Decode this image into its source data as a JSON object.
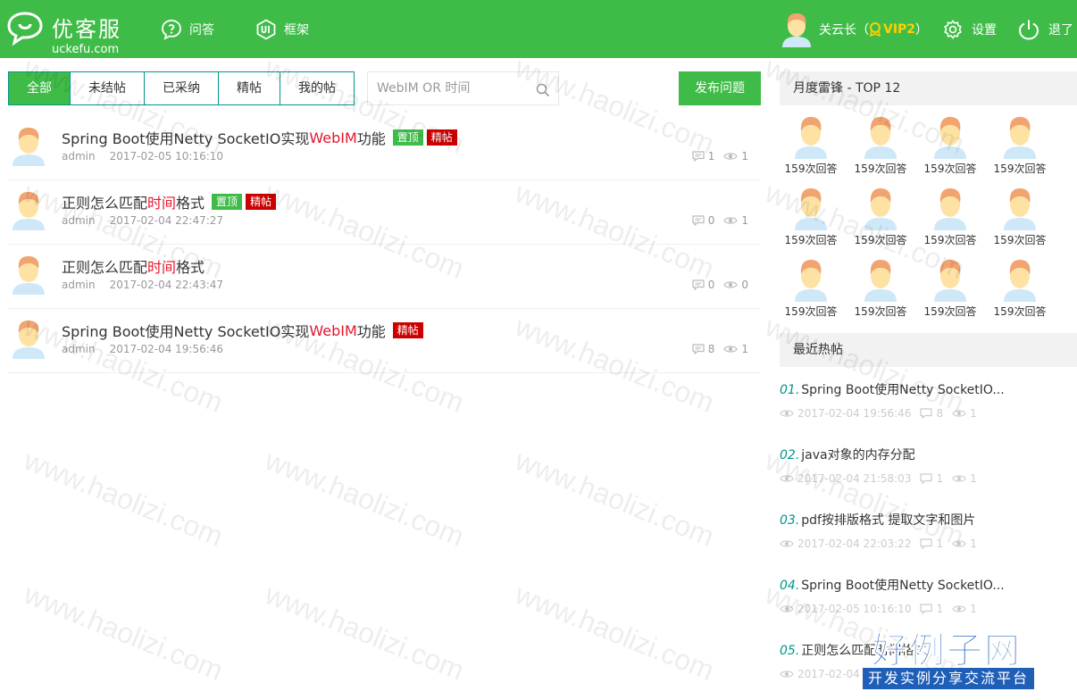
{
  "header": {
    "logo_name": "优客服",
    "logo_domain": "uckefu.com",
    "nav": [
      {
        "label": "问答",
        "icon": "question-bubble-icon"
      },
      {
        "label": "框架",
        "icon": "ui-framework-icon"
      }
    ],
    "user": {
      "name": "关云长（",
      "vip": "VIP2",
      "close": "）"
    },
    "settings_label": "设置",
    "logout_label": "退了"
  },
  "tabs": [
    "全部",
    "未结帖",
    "已采纳",
    "精帖",
    "我的帖"
  ],
  "search": {
    "placeholder": "WebIM OR 时间"
  },
  "publish_label": "发布问题",
  "posts": [
    {
      "pre": "Spring Boot使用Netty SocketIO实现",
      "hl": "WebIM",
      "post": "功能",
      "badges": [
        "置顶",
        "精帖"
      ],
      "author": "admin",
      "time": "2017-02-05 10:16:10",
      "replies": "1",
      "views": "1"
    },
    {
      "pre": "正则怎么匹配",
      "hl": "时间",
      "post": "格式",
      "badges": [
        "置顶",
        "精帖"
      ],
      "author": "admin",
      "time": "2017-02-04 22:47:27",
      "replies": "0",
      "views": "1"
    },
    {
      "pre": "正则怎么匹配",
      "hl": "时间",
      "post": "格式",
      "badges": [],
      "author": "admin",
      "time": "2017-02-04 22:43:47",
      "replies": "0",
      "views": "0"
    },
    {
      "pre": "Spring Boot使用Netty SocketIO实现",
      "hl": "WebIM",
      "post": "功能",
      "badges": [
        "精帖"
      ],
      "author": "admin",
      "time": "2017-02-04 19:56:46",
      "replies": "8",
      "views": "1"
    }
  ],
  "side": {
    "top_title": "月度雷锋 - TOP 12",
    "top_count_label": "159次回答",
    "hot_title": "最近热帖",
    "hot": [
      {
        "num": "01.",
        "title": "Spring Boot使用Netty SocketIO...",
        "time": "2017-02-04 19:56:46",
        "replies": "8",
        "views": "1"
      },
      {
        "num": "02.",
        "title": "java对象的内存分配",
        "time": "2017-02-04 21:58:03",
        "replies": "1",
        "views": "1"
      },
      {
        "num": "03.",
        "title": "pdf按排版格式 提取文字和图片",
        "time": "2017-02-04 22:03:22",
        "replies": "1",
        "views": "1"
      },
      {
        "num": "04.",
        "title": "Spring Boot使用Netty SocketIO...",
        "time": "2017-02-05 10:16:10",
        "replies": "1",
        "views": "1"
      },
      {
        "num": "05.",
        "title": "正则怎么匹配时间格式",
        "time": "2017-02-04",
        "replies": "",
        "views": ""
      }
    ]
  },
  "watermark": "www.haolizi.com",
  "brand": {
    "big": "好例子网",
    "small": "开发实例分享交流平台"
  },
  "colors": {
    "primary": "#3fbc48",
    "teal": "#009688",
    "highlight": "#e4162e",
    "fine_badge": "#cc0000"
  }
}
